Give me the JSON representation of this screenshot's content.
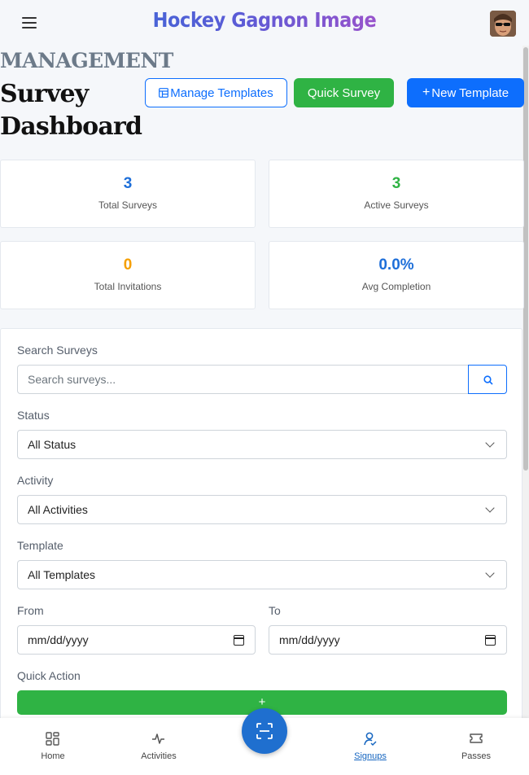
{
  "header": {
    "brand": "Hockey Gagnon Image",
    "menu_icon": "hamburger-menu-icon",
    "avatar_icon": "user-avatar"
  },
  "page": {
    "kicker": "MANAGEMENT",
    "title": "Survey Dashboard"
  },
  "actions": {
    "manage_templates": "Manage Templates",
    "quick_survey": "Quick Survey",
    "new_template": "New Template",
    "manage_icon": "template-list-icon",
    "new_icon": "plus-icon"
  },
  "stats": [
    {
      "value": "3",
      "label": "Total Surveys",
      "color": "#1e6fd9"
    },
    {
      "value": "3",
      "label": "Active Surveys",
      "color": "#2fb344"
    },
    {
      "value": "0",
      "label": "Total Invitations",
      "color": "#f59f00"
    },
    {
      "value": "0.0%",
      "label": "Avg Completion",
      "color": "#1e6fd9"
    }
  ],
  "filters": {
    "search_label": "Search Surveys",
    "search_placeholder": "Search surveys...",
    "status_label": "Status",
    "status_value": "All Status",
    "activity_label": "Activity",
    "activity_value": "All Activities",
    "template_label": "Template",
    "template_value": "All Templates",
    "from_label": "From",
    "from_value": "mm/dd/yyyy",
    "to_label": "To",
    "to_value": "mm/dd/yyyy",
    "quick_action_label": "Quick Action",
    "quick_action_button": "+"
  },
  "nav": {
    "items": [
      {
        "label": "Home",
        "icon": "home-grid-icon"
      },
      {
        "label": "Activities",
        "icon": "activity-pulse-icon"
      },
      {
        "label": "Signups",
        "icon": "user-check-icon",
        "active": true
      },
      {
        "label": "Passes",
        "icon": "ticket-icon"
      }
    ],
    "fab_icon": "qr-scan-icon"
  },
  "colors": {
    "primary": "#0d6efd",
    "success": "#2fb344",
    "warning": "#f59f00"
  }
}
